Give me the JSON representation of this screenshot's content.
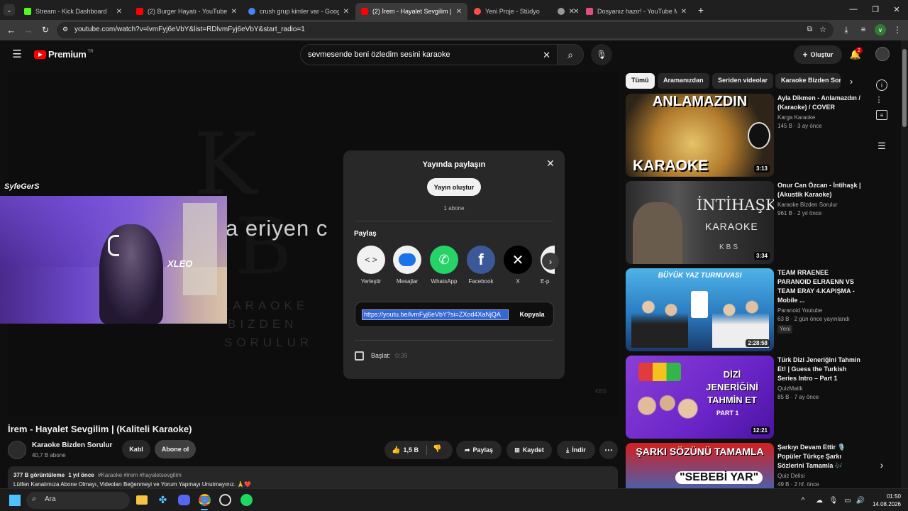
{
  "browser": {
    "tabs": [
      {
        "title": "Stream - Kick Dashboard",
        "color": "#53fc18"
      },
      {
        "title": "(2) Burger Hayatı - YouTube",
        "color": "#ff0000"
      },
      {
        "title": "crush grup kimler var - Google",
        "color": "#4285f4"
      },
      {
        "title": "(2) İrem - Hayalet Sevgilim | (Ka",
        "color": "#ff0000"
      },
      {
        "title": "Yeni Proje - Stüdyo",
        "color": "#ff4e45"
      },
      {
        "title": "",
        "color": "#999999"
      },
      {
        "title": "Dosyanız hazır! - YouTube MP3",
        "color": "#e04f7c"
      }
    ],
    "url": "youtube.com/watch?v=lvmFyj6eVbY&list=RDlvmFyj6eVbY&start_radio=1",
    "profile_initial": "v"
  },
  "youtube": {
    "logo": "Premium",
    "logo_region": "TR",
    "search_value": "sevmesende beni özledim sesini karaoke",
    "create_label": "Oluştur",
    "notification_count": "2"
  },
  "video": {
    "lyric_text": "a eriyen c",
    "bg_letters": "K",
    "watermark_lines": [
      "KARAOKE",
      "BIZDEN",
      "SORULUR"
    ],
    "corner_mark": "KBS",
    "overlay_label": "XLEO",
    "streamer_tag": "SyfeGerS"
  },
  "share": {
    "title": "Yayında paylaşın",
    "create_stream_label": "Yayın oluştur",
    "subscriber_text": "1 abone",
    "section_label": "Paylaş",
    "targets": [
      {
        "label": "Yerleştir",
        "color": "#f1f1f1"
      },
      {
        "label": "Mesajlar",
        "color": "#1a73e8"
      },
      {
        "label": "WhatsApp",
        "color": "#25d366"
      },
      {
        "label": "Facebook",
        "color": "#3b5998"
      },
      {
        "label": "X",
        "color": "#000000"
      },
      {
        "label": "E-p",
        "color": "#f1f1f1"
      }
    ],
    "link": "https://youtu.be/lvmFyj6eVbY?si=ZXod4XaNjQA",
    "copy_label": "Kopyala",
    "start_label": "Başlat:",
    "start_time": "0:39"
  },
  "watch": {
    "title": "İrem - Hayalet Sevgilim | (Kaliteli Karaoke)",
    "channel": "Karaoke Bizden Sorulur",
    "subscribers": "40,7 B abone",
    "join_label": "Katıl",
    "subscribe_label": "Abone ol",
    "likes": "1,5 B",
    "share_label": "Paylaş",
    "save_label": "Kaydet",
    "download_label": "İndir",
    "views": "377 B görüntüleme",
    "age": "1 yıl önce",
    "tags": "#Karaoke #irem #hayaletsevgilim",
    "description": "Lütfen Kanalımıza Abone Olmayı, Videoları Beğenmeyi ve Yorum Yapmayı Unutmayınız. 🙏❤️"
  },
  "chips": [
    "Tümü",
    "Aramanızdan",
    "Seriden videolar",
    "Karaoke Bizden Sor"
  ],
  "recommendations": [
    {
      "title": "Ayla Dikmen - Anlamazdın / (Karaoke) / COVER",
      "channel": "Karga Karaoke",
      "meta": "145 B · 3 ay önce",
      "duration": "3:13",
      "thumb_top": "ANLAMAZDIN",
      "thumb_bottom": "KARAOKE",
      "badge": ""
    },
    {
      "title": "Onur Can Özcan - İntihaşk | (Akustik Karaoke)",
      "channel": "Karaoke Bizden Sorulur",
      "meta": "961 B · 2 yıl önce",
      "duration": "3:34",
      "thumb_top": "İNTİHAŞK",
      "thumb_bottom": "KARAOKE",
      "badge": ""
    },
    {
      "title": "TEAM RRAENEE PARANOID ELRAENN VS TEAM ERAY 4.KAPIŞMA - Mobile ...",
      "channel": "Paranoid Youtube",
      "meta": "63 B · 2 gün önce yayınlandı",
      "duration": "2:28:58",
      "thumb_top": "BÜYÜK YAZ TURNUVASI",
      "thumb_bottom": "",
      "badge": "Yeni"
    },
    {
      "title": "Türk Dizi Jeneriğini Tahmin Et! | Guess the Turkish Series Intro – Part 1",
      "channel": "QuizMatik",
      "meta": "85 B · 7 ay önce",
      "duration": "12:21",
      "thumb_top": "DİZİ JENERİĞİNİ TAHMİN ET",
      "thumb_bottom": "PART 1",
      "badge": ""
    },
    {
      "title": "Şarkıyı Devam Ettir 🎙️ Popüler Türkçe Şarkı Sözlerini Tamamla 🎶",
      "channel": "Quiz Delisi",
      "meta": "49 B · 2 hf. önce",
      "duration": "",
      "thumb_top": "ŞARKI SÖZÜNÜ TAMAMLA",
      "thumb_bottom": "\"SEBEBİ YAR\"",
      "badge": ""
    }
  ],
  "taskbar": {
    "search_label": "Ara",
    "time": "01:50",
    "date": "14.08.2026"
  }
}
